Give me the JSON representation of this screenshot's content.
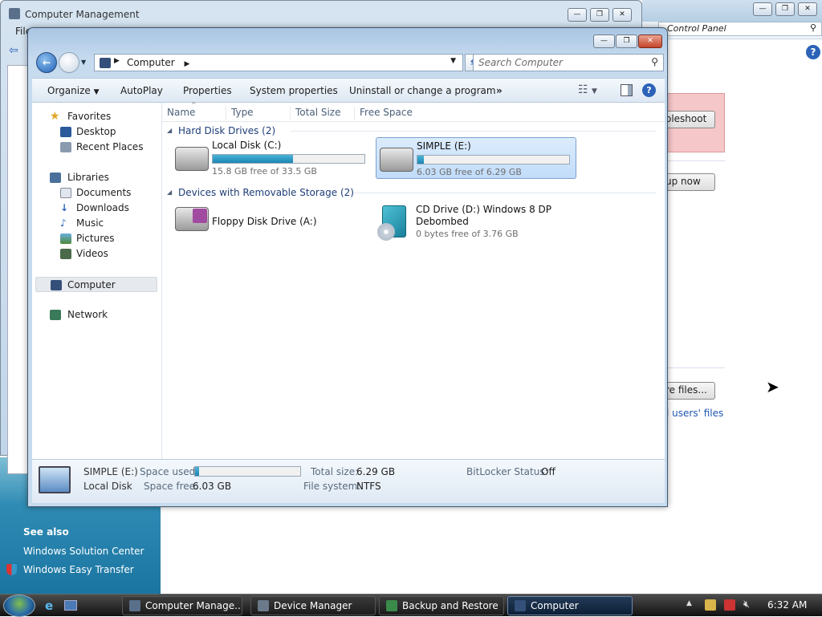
{
  "control_panel": {
    "search_placeholder": "Control Panel",
    "buttons": [
      "oleshoot",
      "up now",
      "re files..."
    ],
    "link": "l users' files",
    "see_also": {
      "title": "See also",
      "items": [
        "Windows Solution Center",
        "Windows Easy Transfer"
      ]
    }
  },
  "computer_management": {
    "title": "Computer Management",
    "menu_first": "File"
  },
  "explorer": {
    "breadcrumb": "Computer",
    "search_placeholder": "Search Computer",
    "toolbar": [
      "Organize",
      "AutoPlay",
      "Properties",
      "System properties",
      "Uninstall or change a program"
    ],
    "toolbar_more": "»",
    "columns": [
      "Name",
      "Type",
      "Total Size",
      "Free Space"
    ],
    "nav": {
      "favorites_header": "Favorites",
      "favorites": [
        "Desktop",
        "Recent Places"
      ],
      "libraries_header": "Libraries",
      "libraries": [
        "Documents",
        "Downloads",
        "Music",
        "Pictures",
        "Videos"
      ],
      "computer": "Computer",
      "network": "Network"
    },
    "groups": {
      "hdd": "Hard Disk Drives (2)",
      "removable": "Devices with Removable Storage (2)"
    },
    "drives": {
      "c": {
        "name": "Local Disk (C:)",
        "free": "15.8 GB free of 33.5 GB",
        "used_fraction": 0.53
      },
      "e": {
        "name": "SIMPLE (E:)",
        "free": "6.03 GB free of 6.29 GB",
        "used_fraction": 0.04
      },
      "a": {
        "name": "Floppy Disk Drive (A:)"
      },
      "d": {
        "name_line1": "CD Drive (D:) Windows 8 DP",
        "name_line2": "Debombed",
        "free": "0 bytes free of 3.76 GB"
      }
    },
    "details": {
      "name": "SIMPLE (E:)",
      "kind": "Local Disk",
      "space_used_label": "Space used:",
      "space_free_label": "Space free:",
      "space_free": "6.03 GB",
      "total_size_label": "Total size:",
      "total_size": "6.29 GB",
      "fs_label": "File system:",
      "fs": "NTFS",
      "bitlocker_label": "BitLocker Status:",
      "bitlocker": "Off",
      "used_fraction": 0.04
    }
  },
  "taskbar": {
    "tasks": [
      "Computer Manage...",
      "Device Manager",
      "Backup and Restore",
      "Computer"
    ],
    "clock": "6:32 AM"
  }
}
